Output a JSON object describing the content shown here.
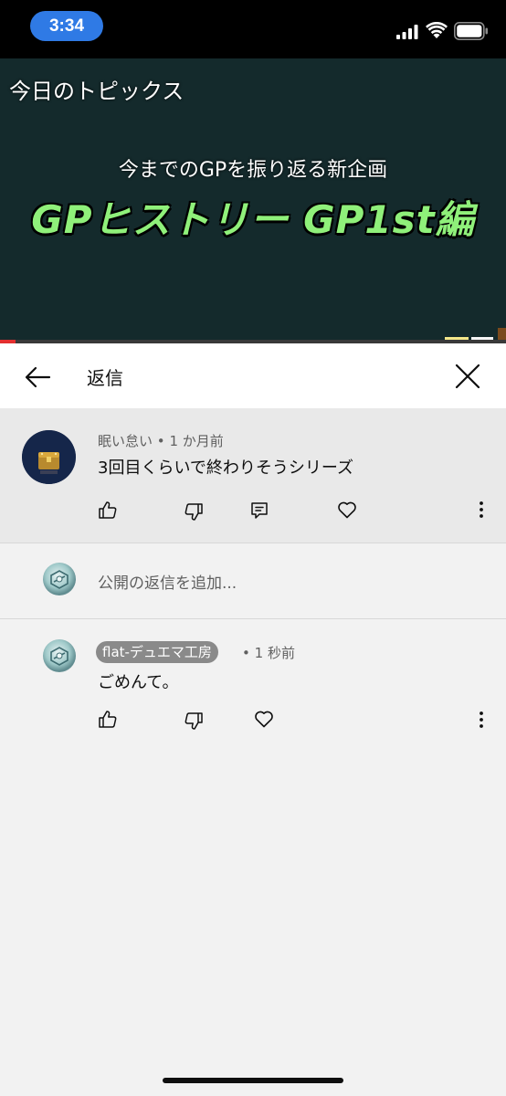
{
  "status_bar": {
    "time": "3:34"
  },
  "video": {
    "topic_label": "今日のトピックス",
    "subtitle": "今までのGPを振り返る新企画",
    "title": "GPヒストリー GP1st編",
    "progress": 0.03
  },
  "header": {
    "title": "返信"
  },
  "parent_comment": {
    "author": "眠い怠い",
    "separator": "•",
    "time": "1 か月前",
    "text": "3回目くらいで終わりそうシリーズ"
  },
  "add_reply": {
    "placeholder": "公開の返信を追加..."
  },
  "reply": {
    "author": "flat-デュエマ工房",
    "separator": "•",
    "time": "1 秒前",
    "text": "ごめんて。"
  },
  "colors": {
    "status_bar_bg": "#000000",
    "time_pill": "#2f7ae5",
    "video_bg": "#142a2c",
    "video_title": "#8ff07a",
    "header_bg": "#ffffff",
    "parent_comment_bg": "#e9e9e9",
    "page_bg": "#f2f2f2",
    "author_chip_bg": "#8a8a8a"
  },
  "icons": {
    "back": "arrow-left-icon",
    "close": "close-icon",
    "like": "thumbs-up-icon",
    "dislike": "thumbs-down-icon",
    "reply": "reply-icon",
    "heart": "heart-icon",
    "more": "more-vertical-icon"
  }
}
